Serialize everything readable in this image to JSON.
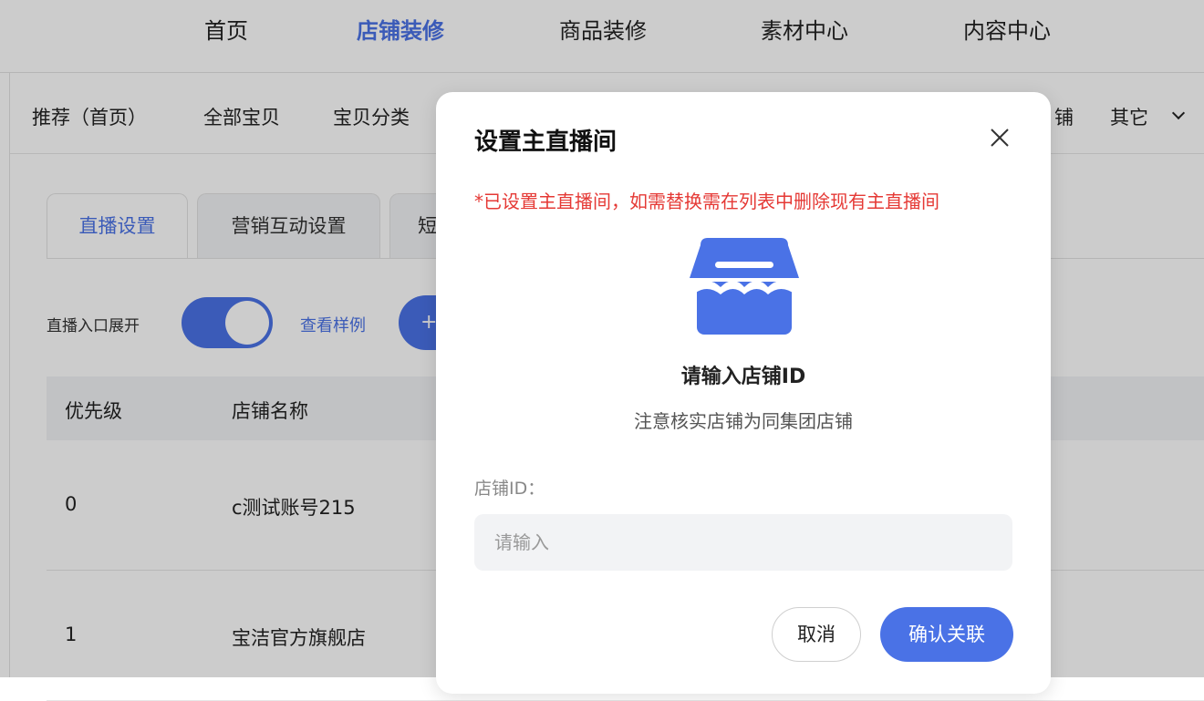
{
  "top_nav": {
    "items": [
      "首页",
      "店铺装修",
      "商品装修",
      "素材中心",
      "内容中心"
    ],
    "active": "店铺装修"
  },
  "sub_nav": {
    "items": [
      "推荐（首页）",
      "全部宝贝",
      "宝贝分类",
      "铺",
      "其它"
    ]
  },
  "tabs": [
    "直播设置",
    "营销互动设置",
    "短"
  ],
  "toolbar": {
    "toggle_label": "直播入口展开",
    "toggle_on": true,
    "view_example": "查看样例",
    "add_label": "+"
  },
  "table": {
    "headers": [
      "优先级",
      "店铺名称"
    ],
    "rows": [
      [
        "0",
        "c测试账号215"
      ],
      [
        "1",
        "宝洁官方旗舰店"
      ]
    ]
  },
  "modal": {
    "title": "设置主直播间",
    "warning": "*已设置主直播间，如需替换需在列表中删除现有主直播间",
    "icon": "shop-icon",
    "heading": "请输入店铺ID",
    "note": "注意核实店铺为同集团店铺",
    "field_label": "店铺ID：",
    "input_value": "",
    "input_placeholder": "请输入",
    "cancel_label": "取消",
    "confirm_label": "确认关联"
  },
  "colors": {
    "accent": "#4a72e6",
    "warning": "#e53935",
    "overlay": "rgba(0,0,0,0.2)"
  }
}
